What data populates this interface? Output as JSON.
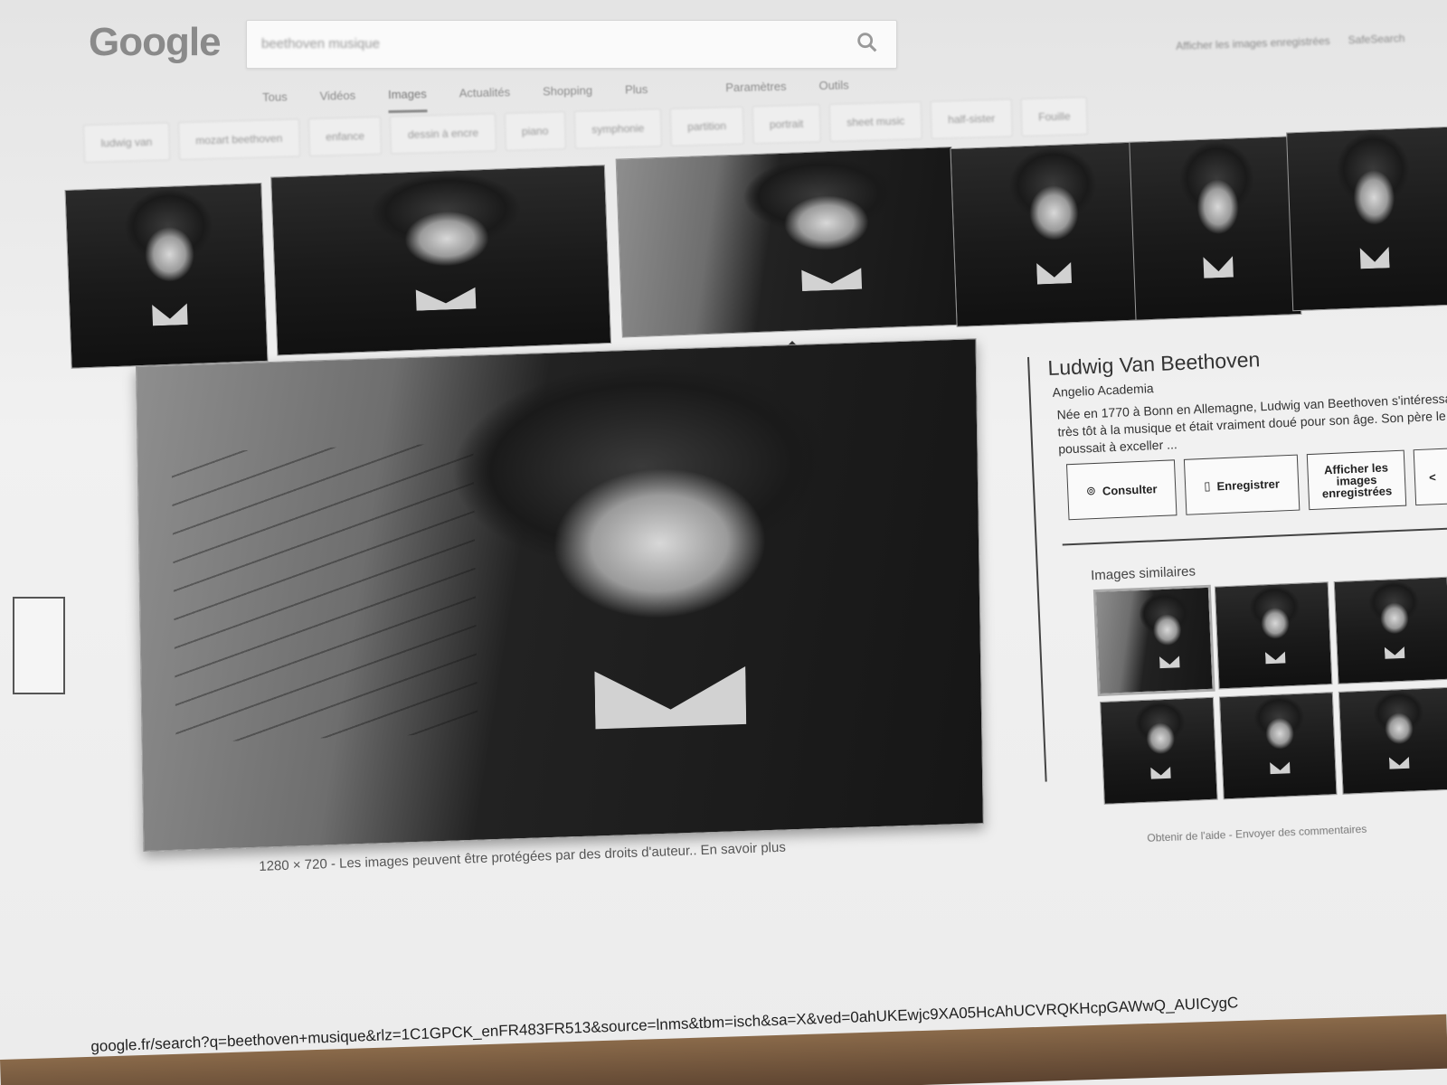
{
  "header": {
    "logo_text": "Google",
    "search_query": "beethoven musique",
    "tabs": [
      "Tous",
      "Vidéos",
      "Images",
      "Actualités",
      "Shopping",
      "Plus",
      "Paramètres",
      "Outils"
    ],
    "active_tab": "Images",
    "saved_images_link": "Afficher les images enregistrées",
    "safesearch_label": "SafeSearch"
  },
  "chips": [
    "ludwig van",
    "mozart beethoven",
    "enfance",
    "dessin à encre",
    "piano",
    "symphonie",
    "partition",
    "portrait",
    "sheet music",
    "half-sister",
    "Fouille"
  ],
  "thumbnails": [
    {
      "alt": "beethoven-writing"
    },
    {
      "alt": "beethoven-portrait"
    },
    {
      "alt": "beethoven-music-sheet",
      "selected": true
    },
    {
      "alt": "beethoven-engraving"
    },
    {
      "alt": "beethoven-painting"
    },
    {
      "alt": "beethoven-closeup"
    }
  ],
  "preview": {
    "dimensions": "1280 × 720",
    "separator": "-",
    "copyright_text": "Les images peuvent être protégées par des droits d'auteur..",
    "learn_more": "En savoir plus"
  },
  "panel": {
    "title": "Ludwig Van Beethoven",
    "source": "Angelio Academia",
    "description": "Née en 1770 à Bonn en Allemagne, Ludwig van Beethoven s'intéressa très tôt à la musique et était vraiment doué pour son âge. Son père le poussait à exceller ...",
    "btn_visit": "Consulter",
    "btn_save": "Enregistrer",
    "btn_saved": "Afficher les images enregistrées",
    "btn_more": "<",
    "similar_label": "Images similaires",
    "similar_images": 8,
    "help_link": "Obtenir de l'aide",
    "feedback_link": "Envoyer des commentaires",
    "footer_separator": "-"
  },
  "url_bar": "google.fr/search?q=beethoven+musique&rlz=1C1GPCK_enFR483FR513&source=lnms&tbm=isch&sa=X&ved=0ahUKEwjc9XA05HcAhUCVRQKHcpGAWwQ_AUICygC",
  "colors": {
    "paper": "#efefef",
    "ink": "#222222",
    "muted": "#8a8a8a",
    "table": "#6b4f36"
  }
}
